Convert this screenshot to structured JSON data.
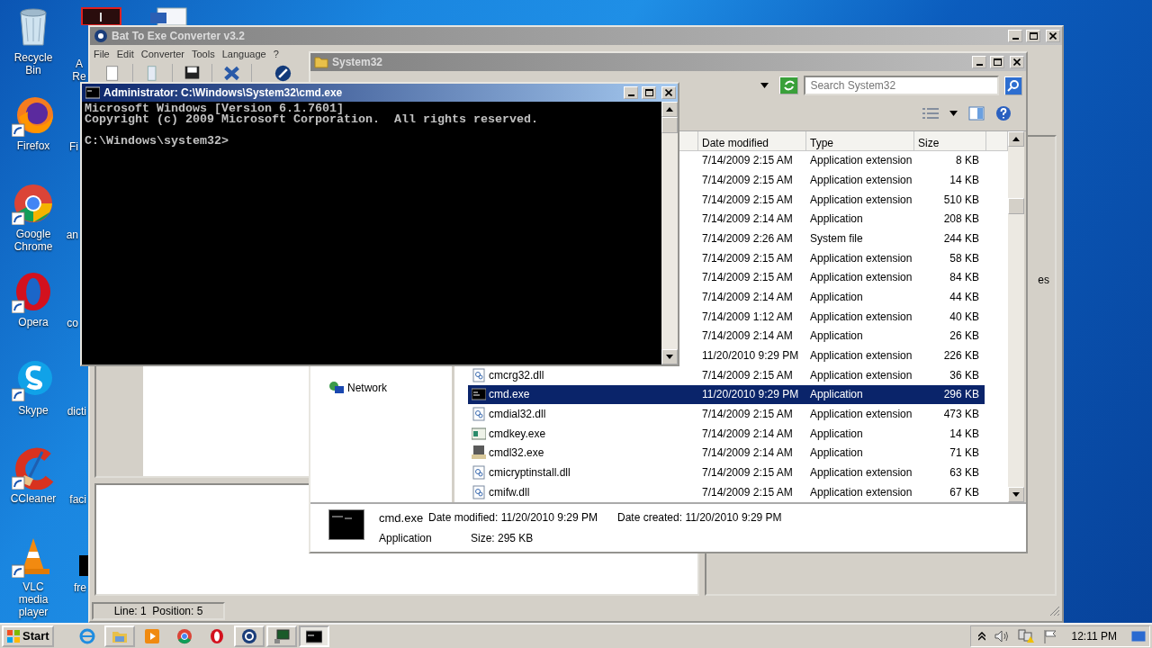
{
  "desktop": {
    "icons": [
      {
        "label": "Recycle Bin",
        "kind": "recycle"
      },
      {
        "label": "Firefox",
        "kind": "firefox"
      },
      {
        "label": "Google Chrome",
        "kind": "chrome"
      },
      {
        "label": "Opera",
        "kind": "opera"
      },
      {
        "label": "Skype",
        "kind": "skype"
      },
      {
        "label": "CCleaner",
        "kind": "ccleaner"
      },
      {
        "label": "VLC media player",
        "kind": "vlc"
      }
    ],
    "partial_labels": [
      "A Re",
      "Fi",
      "an",
      "co",
      "dicti",
      "faci",
      "fre"
    ]
  },
  "bat_window": {
    "title": "Bat To Exe Converter v3.2",
    "active": false,
    "menu": [
      "File",
      "Edit",
      "Converter",
      "Tools",
      "Language",
      "?"
    ],
    "side_text": "es",
    "status": "Line: 1  Position: 5"
  },
  "explorer": {
    "title": "System32",
    "active": false,
    "search": {
      "placeholder": "Search System32"
    },
    "nav": [
      {
        "label": "Network"
      }
    ],
    "columns": [
      "Date modified",
      "Type",
      "Size"
    ],
    "rows": [
      {
        "date": "7/14/2009 2:15 AM",
        "type": "Application extension",
        "size": "8 KB",
        "selected": false
      },
      {
        "date": "7/14/2009 2:15 AM",
        "type": "Application extension",
        "size": "14 KB",
        "selected": false
      },
      {
        "date": "7/14/2009 2:15 AM",
        "type": "Application extension",
        "size": "510 KB",
        "selected": false
      },
      {
        "date": "7/14/2009 2:14 AM",
        "type": "Application",
        "size": "208 KB",
        "selected": false
      },
      {
        "date": "7/14/2009 2:26 AM",
        "type": "System file",
        "size": "244 KB",
        "selected": false
      },
      {
        "date": "7/14/2009 2:15 AM",
        "type": "Application extension",
        "size": "58 KB",
        "selected": false
      },
      {
        "date": "7/14/2009 2:15 AM",
        "type": "Application extension",
        "size": "84 KB",
        "selected": false
      },
      {
        "date": "7/14/2009 2:14 AM",
        "type": "Application",
        "size": "44 KB",
        "selected": false
      },
      {
        "date": "7/14/2009 1:12 AM",
        "type": "Application extension",
        "size": "40 KB",
        "selected": false
      },
      {
        "date": "7/14/2009 2:14 AM",
        "type": "Application",
        "size": "26 KB",
        "selected": false
      },
      {
        "date": "11/20/2010 9:29 PM",
        "type": "Application extension",
        "size": "226 KB",
        "selected": false
      },
      {
        "name": "cmcrg32.dll",
        "kind": "dll",
        "date": "7/14/2009 2:15 AM",
        "type": "Application extension",
        "size": "36 KB",
        "selected": false
      },
      {
        "name": "cmd.exe",
        "kind": "console",
        "date": "11/20/2010 9:29 PM",
        "type": "Application",
        "size": "296 KB",
        "selected": true
      },
      {
        "name": "cmdial32.dll",
        "kind": "dll",
        "date": "7/14/2009 2:15 AM",
        "type": "Application extension",
        "size": "473 KB",
        "selected": false
      },
      {
        "name": "cmdkey.exe",
        "kind": "app",
        "date": "7/14/2009 2:14 AM",
        "type": "Application",
        "size": "14 KB",
        "selected": false
      },
      {
        "name": "cmdl32.exe",
        "kind": "setup",
        "date": "7/14/2009 2:14 AM",
        "type": "Application",
        "size": "71 KB",
        "selected": false
      },
      {
        "name": "cmicryptinstall.dll",
        "kind": "dll",
        "date": "7/14/2009 2:15 AM",
        "type": "Application extension",
        "size": "63 KB",
        "selected": false
      },
      {
        "name": "cmifw.dll",
        "kind": "dll",
        "date": "7/14/2009 2:15 AM",
        "type": "Application extension",
        "size": "67 KB",
        "selected": false
      }
    ],
    "details": {
      "name": "cmd.exe",
      "type": "Application",
      "modified": "Date modified: 11/20/2010 9:29 PM",
      "created": "Date created: 11/20/2010 9:29 PM",
      "size": "Size: 295 KB"
    }
  },
  "cmd": {
    "title": "Administrator: C:\\Windows\\System32\\cmd.exe",
    "active": true,
    "output": "Microsoft Windows [Version 6.1.7601]\nCopyright (c) 2009 Microsoft Corporation.  All rights reserved.\n\nC:\\Windows\\system32>"
  },
  "taskbar": {
    "start": "Start",
    "items": [
      {
        "kind": "ie",
        "running": false,
        "selected": false
      },
      {
        "kind": "folder",
        "running": true,
        "selected": false
      },
      {
        "kind": "media",
        "running": false,
        "selected": false
      },
      {
        "kind": "chrome",
        "running": false,
        "selected": false
      },
      {
        "kind": "opera",
        "running": false,
        "selected": false
      },
      {
        "kind": "gear",
        "running": true,
        "selected": false
      },
      {
        "kind": "monitor",
        "running": true,
        "selected": false
      },
      {
        "kind": "console",
        "running": true,
        "selected": true
      }
    ],
    "clock": "12:11 PM"
  }
}
